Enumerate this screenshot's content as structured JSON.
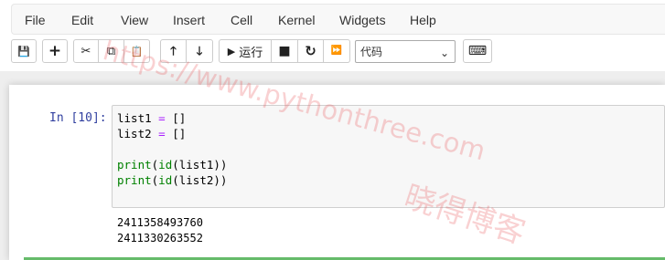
{
  "menubar": {
    "items": [
      "File",
      "Edit",
      "View",
      "Insert",
      "Cell",
      "Kernel",
      "Widgets",
      "Help"
    ]
  },
  "toolbar": {
    "buttons": [
      {
        "icon": "save-icon",
        "glyph": "💾"
      },
      {
        "icon": "plus-icon",
        "glyph": "+"
      },
      {
        "icon": "cut-icon",
        "glyph": "✂"
      },
      {
        "icon": "copy-icon",
        "glyph": "⧉"
      },
      {
        "icon": "paste-icon",
        "glyph": "📋"
      },
      {
        "icon": "arrow-up-icon",
        "glyph": "🡑"
      },
      {
        "icon": "arrow-down-icon",
        "glyph": "🡓"
      },
      {
        "icon": "run-icon",
        "glyph": "▶"
      },
      {
        "icon": "stop-icon",
        "glyph": "■"
      },
      {
        "icon": "restart-icon",
        "glyph": "↻"
      },
      {
        "icon": "fast-forward-icon",
        "glyph": "⏩"
      },
      {
        "icon": "keyboard-icon",
        "glyph": "⌨"
      }
    ],
    "run_label": "运行",
    "cell_type": "代码",
    "caret": "⌄"
  },
  "cell": {
    "prompt": "In  [10]:",
    "code": {
      "line1_var": "list1",
      "line1_eq": " = ",
      "line1_val": "[]",
      "line2_var": "list2",
      "line2_eq": " = ",
      "line2_val": "[]",
      "print": "print",
      "id": "id",
      "line4_arg": "(list1))",
      "line5_arg": "(list2))",
      "paren": "("
    },
    "output": [
      "2411358493760",
      "2411330263552"
    ]
  },
  "watermark": {
    "url": "https://www.pythonthree.com",
    "name": "晓得博客"
  },
  "colors": {
    "prompt": "#303f9f",
    "keyword": "#008000",
    "operator": "#aa22ff",
    "selected_cell_border": "#66bb6a"
  }
}
